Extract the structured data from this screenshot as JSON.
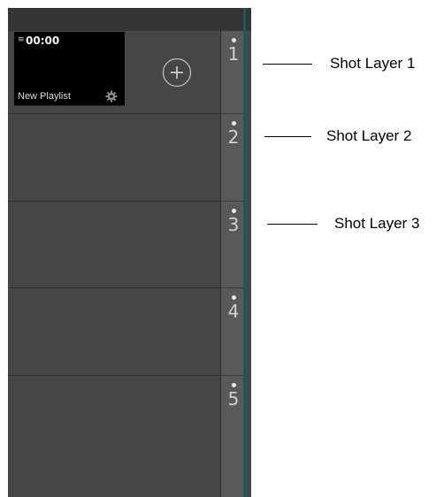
{
  "layers_panel": {
    "playlist": {
      "timecode": "00:00",
      "name": "New Playlist"
    },
    "layer_numbers": [
      "1",
      "2",
      "3",
      "4",
      "5"
    ]
  },
  "callouts": [
    {
      "label": "Shot Layer 1"
    },
    {
      "label": "Shot Layer 2"
    },
    {
      "label": "Shot Layer 3"
    }
  ]
}
